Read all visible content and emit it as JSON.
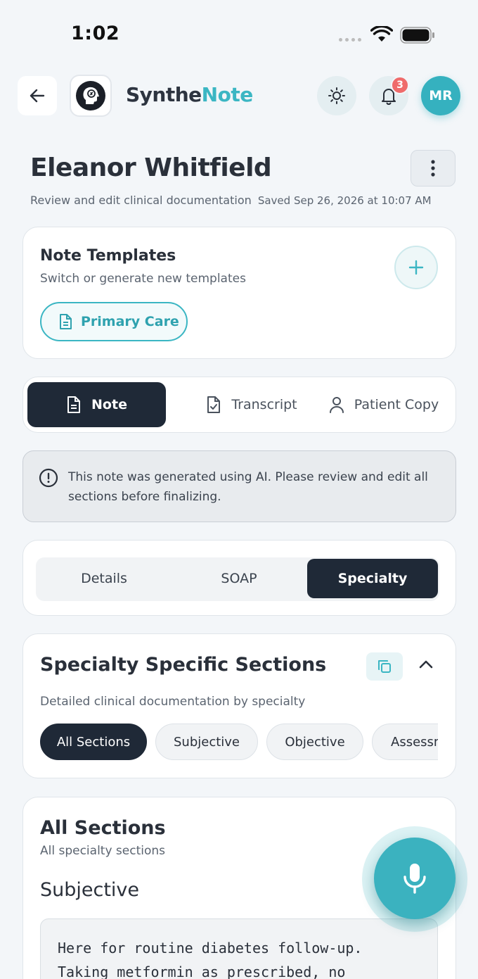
{
  "status_bar": {
    "time": "1:02"
  },
  "header": {
    "brand_part1": "Synthe",
    "brand_part2": "Note",
    "notification_count": "3",
    "avatar_initials": "MR"
  },
  "patient": {
    "name": "Eleanor Whitfield",
    "subtitle": "Review and edit clinical documentation",
    "saved": "Saved Sep 26, 2026 at 10:07 AM"
  },
  "templates": {
    "title": "Note Templates",
    "subtitle": "Switch or generate new templates",
    "selected": "Primary Care"
  },
  "view_tabs": [
    {
      "label": "Note",
      "active": true
    },
    {
      "label": "Transcript",
      "active": false
    },
    {
      "label": "Patient Copy",
      "active": false
    }
  ],
  "ai_notice": "This note was generated using AI. Please review and edit all sections before finalizing.",
  "segments": [
    {
      "label": "Details",
      "active": false
    },
    {
      "label": "SOAP",
      "active": false
    },
    {
      "label": "Specialty",
      "active": true
    }
  ],
  "specialty": {
    "title": "Specialty Specific Sections",
    "subtitle": "Detailed clinical documentation by specialty",
    "chips": [
      "All Sections",
      "Subjective",
      "Objective",
      "Assessment"
    ],
    "active_chip": "All Sections"
  },
  "all_sections": {
    "title": "All Sections",
    "subtitle": "All specialty sections",
    "subjective_heading": "Subjective",
    "subjective_text": "Here for routine diabetes follow-up.\nTaking metformin as prescribed, no"
  },
  "colors": {
    "accent": "#3bb6c3",
    "dark": "#1f2937",
    "badge": "#ef6b6b"
  }
}
